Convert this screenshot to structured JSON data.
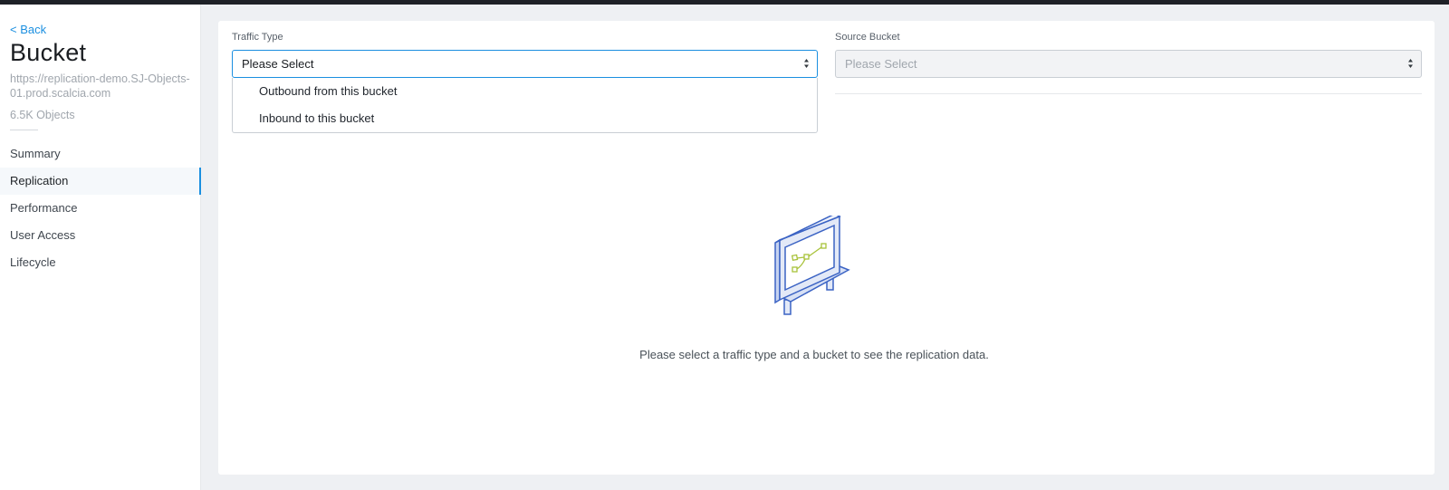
{
  "sidebar": {
    "back_label": "< Back",
    "title": "Bucket",
    "url": "https://replication-demo.SJ-Objects-01.prod.scalcia.com",
    "object_count": "6.5K Objects",
    "nav_items": [
      {
        "label": "Summary",
        "active": false
      },
      {
        "label": "Replication",
        "active": true
      },
      {
        "label": "Performance",
        "active": false
      },
      {
        "label": "User Access",
        "active": false
      },
      {
        "label": "Lifecycle",
        "active": false
      }
    ]
  },
  "filters": {
    "traffic_type": {
      "label": "Traffic Type",
      "value": "Please Select",
      "options": [
        "Outbound from this bucket",
        "Inbound to this bucket"
      ]
    },
    "source_bucket": {
      "label": "Source Bucket",
      "placeholder": "Please Select",
      "disabled": true
    }
  },
  "empty_state": {
    "icon": "monitor-diagram-icon",
    "message": "Please select a traffic type and a bucket to see the replication data."
  },
  "colors": {
    "accent": "#1b8fe0",
    "illustration_blue": "#3b63c4",
    "illustration_green": "#a8c23a"
  }
}
